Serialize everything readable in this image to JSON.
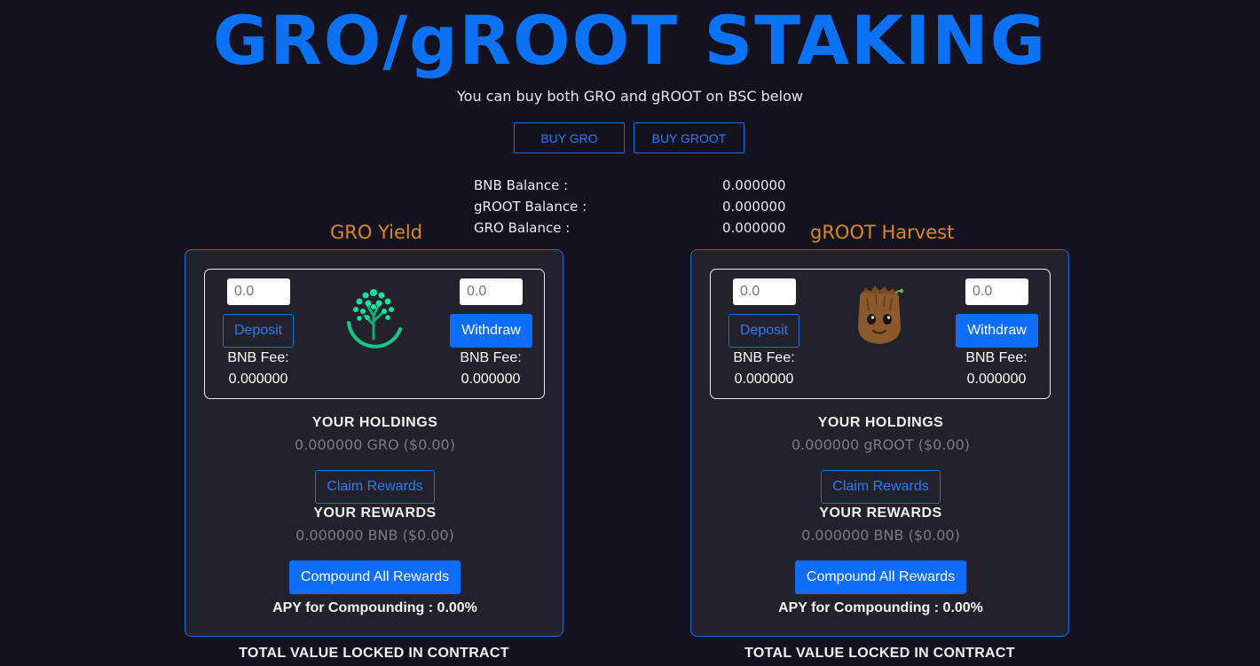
{
  "header": {
    "title": "GRO/gROOT STAKING",
    "subtitle": "You can buy both GRO and gROOT on BSC below",
    "buy_gro": "BUY GRO",
    "buy_groot": "BUY GROOT"
  },
  "balances": [
    {
      "label": "BNB Balance :",
      "value": "0.000000"
    },
    {
      "label": "gROOT Balance :",
      "value": "0.000000"
    },
    {
      "label": "GRO Balance :",
      "value": "0.000000"
    }
  ],
  "pools": [
    {
      "title": "GRO Yield",
      "logo": "tree-icon",
      "deposit_placeholder": "0.0",
      "withdraw_placeholder": "0.0",
      "deposit_label": "Deposit",
      "withdraw_label": "Withdraw",
      "fee_label": "BNB Fee:",
      "deposit_fee": "0.000000",
      "withdraw_fee": "0.000000",
      "holdings_title": "YOUR HOLDINGS",
      "holdings_value": "0.000000 GRO ($0.00)",
      "claim_label": "Claim Rewards",
      "rewards_title": "YOUR REWARDS",
      "rewards_value": "0.000000 BNB ($0.00)",
      "compound_label": "Compound All Rewards",
      "apy": "APY for Compounding : 0.00%",
      "tvl_title": "TOTAL VALUE LOCKED IN CONTRACT"
    },
    {
      "title": "gROOT Harvest",
      "logo": "groot-face-icon",
      "deposit_placeholder": "0.0",
      "withdraw_placeholder": "0.0",
      "deposit_label": "Deposit",
      "withdraw_label": "Withdraw",
      "fee_label": "BNB Fee:",
      "deposit_fee": "0.000000",
      "withdraw_fee": "0.000000",
      "holdings_title": "YOUR HOLDINGS",
      "holdings_value": "0.000000 gROOT ($0.00)",
      "claim_label": "Claim Rewards",
      "rewards_title": "YOUR REWARDS",
      "rewards_value": "0.000000 BNB ($0.00)",
      "compound_label": "Compound All Rewards",
      "apy": "APY for Compounding : 0.00%",
      "tvl_title": "TOTAL VALUE LOCKED IN CONTRACT"
    }
  ],
  "colors": {
    "background": "#15121f",
    "accent": "#0d6efd",
    "title": "#0b72f5",
    "panel_title": "#d88a1c",
    "panel_bg": "#23212c"
  }
}
